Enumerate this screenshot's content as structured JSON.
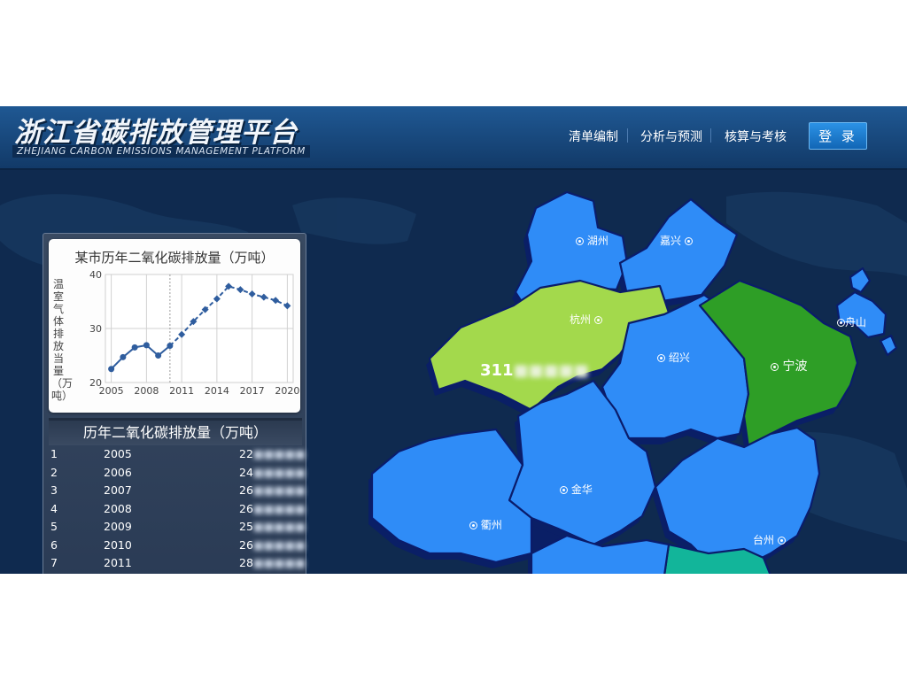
{
  "header": {
    "logo_cn": "浙江省碳排放管理平台",
    "logo_en": "ZHEJIANG CARBON EMISSIONS MANAGEMENT PLATFORM",
    "nav": [
      "清单编制",
      "分析与预测",
      "核算与考核"
    ],
    "login": "登 录"
  },
  "colors": {
    "header_bg": "#1a4d85",
    "page_bg": "#0f2a4f",
    "map_blue": "#2f8cf7",
    "map_lime": "#a3d94c",
    "map_green": "#2e9e26",
    "map_teal": "#12b59a",
    "login_btn": "#1f7fd6"
  },
  "map": {
    "cities": [
      "湖州",
      "嘉兴",
      "杭州",
      "舟山",
      "绍兴",
      "宁波",
      "金华",
      "衢州",
      "台州"
    ],
    "highlight_value": "311"
  },
  "chart_data": {
    "type": "line",
    "title": "某市历年二氧化碳排放量（万吨）",
    "ylabel": "温室气体排放当量（万吨）",
    "xlabel": "",
    "x": [
      2005,
      2006,
      2007,
      2008,
      2009,
      2010,
      2011,
      2012,
      2013,
      2014,
      2015,
      2016,
      2017,
      2018,
      2019,
      2020
    ],
    "values": [
      22.5,
      24.7,
      26.5,
      26.9,
      25.0,
      26.8,
      28.9,
      31.3,
      33.5,
      35.5,
      37.8,
      37.2,
      36.4,
      35.8,
      35.2,
      34.2
    ],
    "x_ticks": [
      2005,
      2008,
      2011,
      2014,
      2017,
      2020
    ],
    "y_ticks": [
      20,
      30,
      40
    ],
    "ylim": [
      20,
      40
    ],
    "xlim": [
      2004.5,
      2020.5
    ],
    "grid": true,
    "dashed_after": 2010
  },
  "table": {
    "title": "历年二氧化碳排放量（万吨）",
    "rows": [
      {
        "idx": "1",
        "year": "2005",
        "value": "22"
      },
      {
        "idx": "2",
        "year": "2006",
        "value": "24"
      },
      {
        "idx": "3",
        "year": "2007",
        "value": "26"
      },
      {
        "idx": "4",
        "year": "2008",
        "value": "26"
      },
      {
        "idx": "5",
        "year": "2009",
        "value": "25"
      },
      {
        "idx": "6",
        "year": "2010",
        "value": "26"
      },
      {
        "idx": "7",
        "year": "2011",
        "value": "28"
      }
    ]
  }
}
